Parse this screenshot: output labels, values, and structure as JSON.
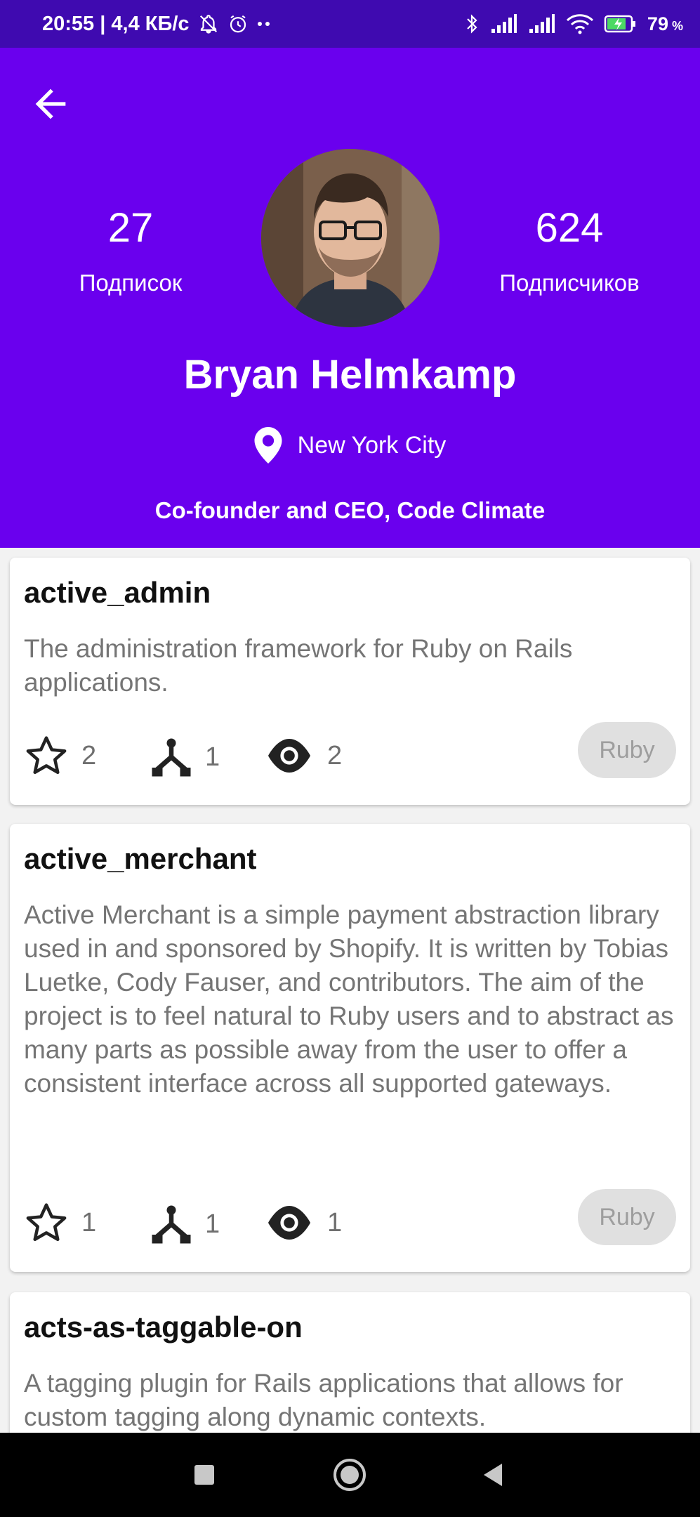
{
  "status_bar": {
    "time_info": "20:55 | 4,4 КБ/с",
    "battery_percent": "79",
    "battery_unit": "%",
    "icons": [
      "notifications-off-icon",
      "alarm-icon",
      "more-dots-icon",
      "bluetooth-icon",
      "signal-icon",
      "signal-icon-2",
      "wifi-icon",
      "battery-charging-icon"
    ]
  },
  "profile": {
    "following_count": "27",
    "following_label": "Подписок",
    "followers_count": "624",
    "followers_label": "Подписчиков",
    "name": "Bryan Helmkamp",
    "location": "New York City",
    "bio": "Co-founder and CEO, Code Climate"
  },
  "repos": [
    {
      "name": "active_admin",
      "description": "The administration framework for Ruby on Rails applications.",
      "stars": "2",
      "forks": "1",
      "watchers": "2",
      "language": "Ruby"
    },
    {
      "name": "active_merchant",
      "description": "Active Merchant is a simple payment abstraction library used in and sponsored by Shopify. It is written by Tobias Luetke, Cody Fauser, and contributors. The aim of the project is to feel natural to Ruby users and to abstract as many parts as possible away from the user to offer a consistent interface across all supported gateways.",
      "stars": "1",
      "forks": "1",
      "watchers": "1",
      "language": "Ruby"
    },
    {
      "name": "acts-as-taggable-on",
      "description": "A tagging plugin for Rails applications that allows for custom tagging along dynamic contexts."
    }
  ],
  "colors": {
    "status_bar": "#3f0ab0",
    "header": "#6a00ee",
    "chip_bg": "#e0e0e0",
    "chip_text": "#9e9e9e"
  }
}
